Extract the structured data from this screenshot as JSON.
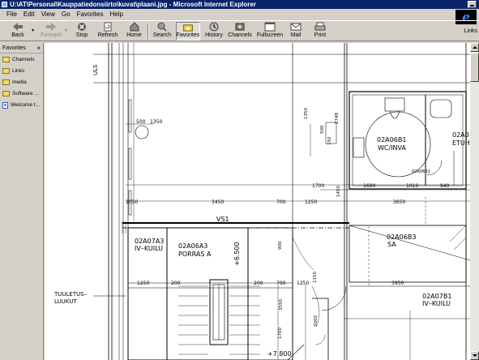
{
  "window": {
    "title": "U:\\AT\\Personal\\Kauppatiedonsiirto\\kuvat\\plaani.jpg - Microsoft Internet Explorer"
  },
  "menu": [
    "File",
    "Edit",
    "View",
    "Go",
    "Favorites",
    "Help"
  ],
  "toolbar": {
    "back": "Back",
    "forward": "Forward",
    "stop": "Stop",
    "refresh": "Refresh",
    "home": "Home",
    "search": "Search",
    "favorites": "Favorites",
    "history": "History",
    "channels": "Channels",
    "fullscreen": "Fullscreen",
    "mail": "Mail",
    "print": "Print"
  },
  "links_label": "Links",
  "favorites_pane": {
    "title": "Favorites",
    "close": "×",
    "items": [
      {
        "label": "Channels",
        "icon": "folder-icon"
      },
      {
        "label": "Links",
        "icon": "folder-icon"
      },
      {
        "label": "media",
        "icon": "folder-icon"
      },
      {
        "label": "Software ...",
        "icon": "folder-icon"
      },
      {
        "label": "Welcome t...",
        "icon": "page-icon"
      }
    ]
  },
  "plan": {
    "ulsh": "ULS",
    "vs1": "VS1",
    "dims": {
      "d1350a": "1350",
      "d500a": "500",
      "d1050": "1050",
      "d3450": "3450",
      "d700": "700",
      "d1250": "1250",
      "d1450": "1450",
      "d1700": "1700",
      "d1690": "1690",
      "d1010": "1010",
      "d940": "940",
      "d2748": "2748",
      "d500b": "500",
      "d150": "150",
      "d3650": "3650",
      "d1250b": "1250",
      "d200a": "200",
      "d200b": "200",
      "d700b": "700",
      "d1250c": "1250",
      "d1150": "1150",
      "d3950": "3950",
      "d3550": "3550",
      "d900": "900",
      "d1700b": "1700",
      "d1350b": "1350",
      "d2000": "2000"
    },
    "rooms": {
      "r1_code": "02A06B1",
      "r1_name": "WC/INVA",
      "r1_small": "02A06B1",
      "r2_code": "02A0",
      "r2_name": "ETUH",
      "r3_code": "02A07A3",
      "r3_name": "IV–KUILU",
      "r4_code": "02A06A3",
      "r4_name": "PORRAS A",
      "r5_code": "02A06B3",
      "r5_name": "SA",
      "r6_code": "02A07B1",
      "r6_name": "IV–KUILU"
    },
    "level1": "+6.500",
    "level2": "+7.800",
    "tuuletus1": "TUULETUS–",
    "tuuletus2": "LUUKUT"
  }
}
